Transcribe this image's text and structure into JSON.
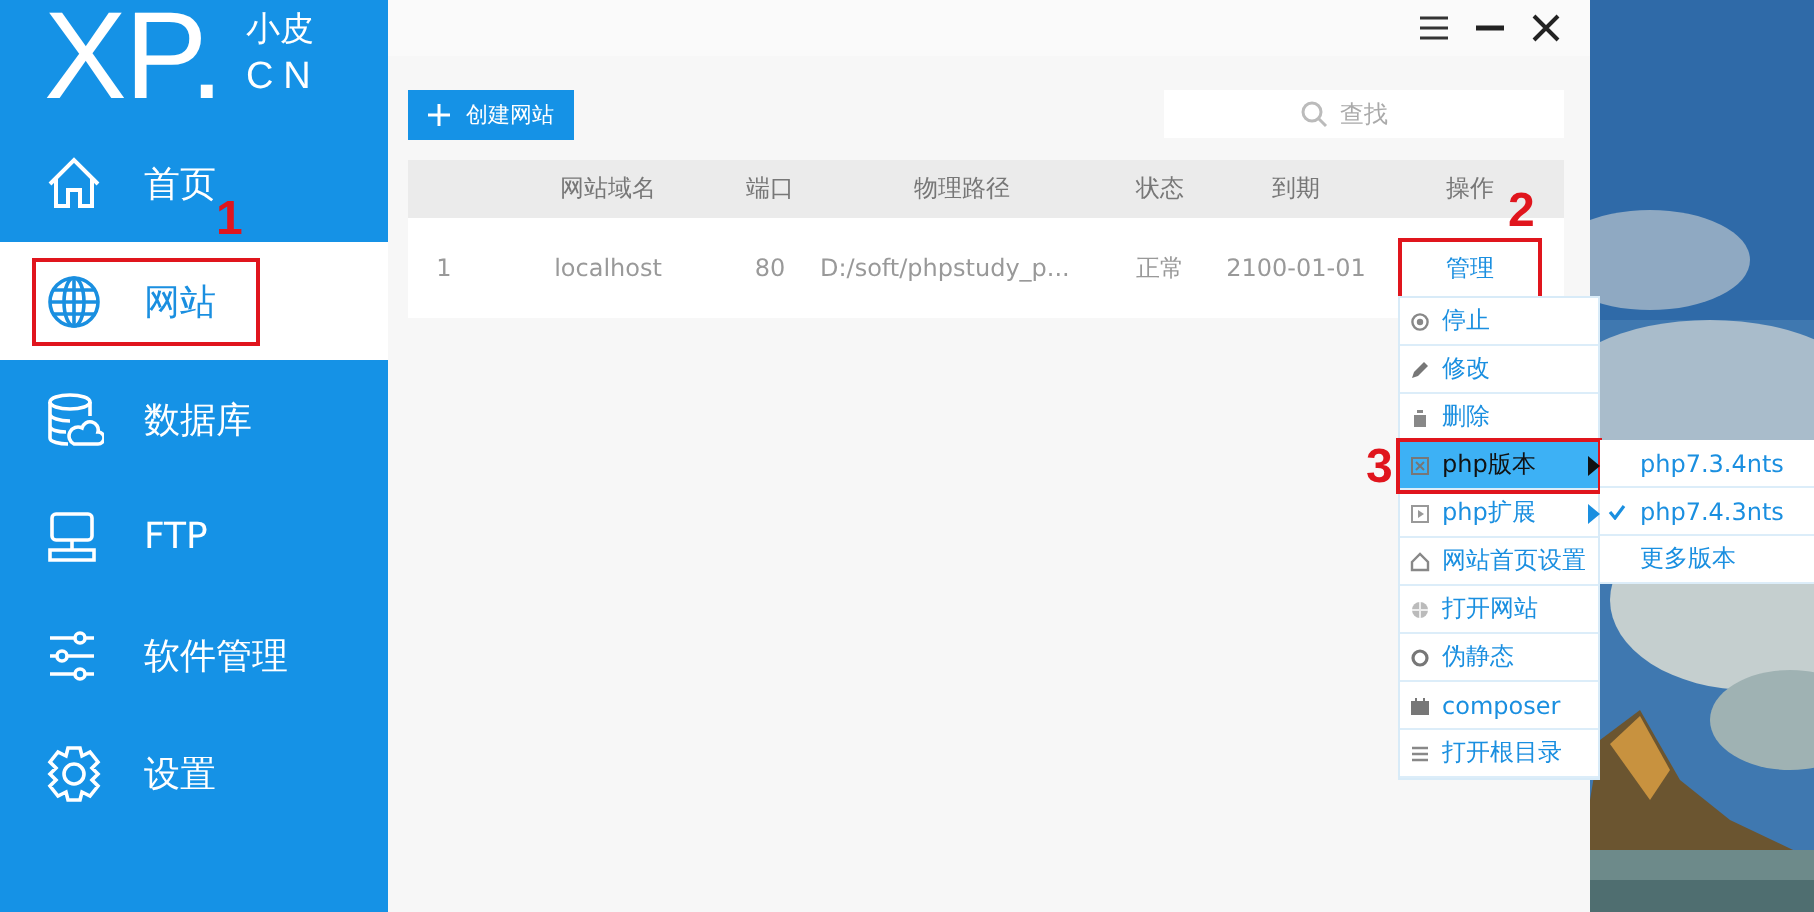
{
  "logo": {
    "mark": "XP.",
    "name": "小皮",
    "domain": "CN"
  },
  "sidebar": {
    "items": [
      {
        "label": "首页",
        "kind": "home",
        "selected": false
      },
      {
        "label": "网站",
        "kind": "globe",
        "selected": true,
        "callout": "1"
      },
      {
        "label": "数据库",
        "kind": "database",
        "selected": false
      },
      {
        "label": "FTP",
        "kind": "ftp",
        "selected": false
      },
      {
        "label": "软件管理",
        "kind": "sliders",
        "selected": false
      },
      {
        "label": "设置",
        "kind": "gear",
        "selected": false
      }
    ]
  },
  "window_controls": [
    {
      "kind": "menu"
    },
    {
      "kind": "minimize"
    },
    {
      "kind": "close"
    }
  ],
  "toolbar": {
    "create_button": "创建网站",
    "search": {
      "placeholder": "查找"
    }
  },
  "table": {
    "columns": [
      "",
      "网站域名",
      "端口",
      "物理路径",
      "状态",
      "到期",
      "操作"
    ],
    "rows": [
      {
        "cells": [
          "1",
          "localhost",
          "80",
          "D:/soft/phpstudy_p...",
          "正常",
          "2100-01-01"
        ],
        "action": "管理",
        "action_callout": "2"
      }
    ]
  },
  "context_menu": {
    "items": [
      {
        "label": "停止",
        "kind": "stop",
        "selected": false,
        "submenu": false
      },
      {
        "label": "修改",
        "kind": "edit",
        "selected": false,
        "submenu": false
      },
      {
        "label": "删除",
        "kind": "delete",
        "selected": false,
        "submenu": false
      },
      {
        "label": "php版本",
        "kind": "version",
        "selected": true,
        "submenu": true,
        "callout": "3"
      },
      {
        "label": "php扩展",
        "kind": "extension",
        "selected": false,
        "submenu": true
      },
      {
        "label": "网站首页设置",
        "kind": "home",
        "selected": false,
        "submenu": false
      },
      {
        "label": "打开网站",
        "kind": "globe",
        "selected": false,
        "submenu": false
      },
      {
        "label": "伪静态",
        "kind": "rewrite",
        "selected": false,
        "submenu": false
      },
      {
        "label": "composer",
        "kind": "package",
        "selected": false,
        "submenu": false
      },
      {
        "label": "打开根目录",
        "kind": "list",
        "selected": false,
        "submenu": false
      }
    ]
  },
  "submenu": {
    "items": [
      {
        "label": "php7.3.4nts",
        "checked": false
      },
      {
        "label": "php7.4.3nts",
        "checked": true
      },
      {
        "label": "更多版本",
        "checked": false
      }
    ]
  }
}
